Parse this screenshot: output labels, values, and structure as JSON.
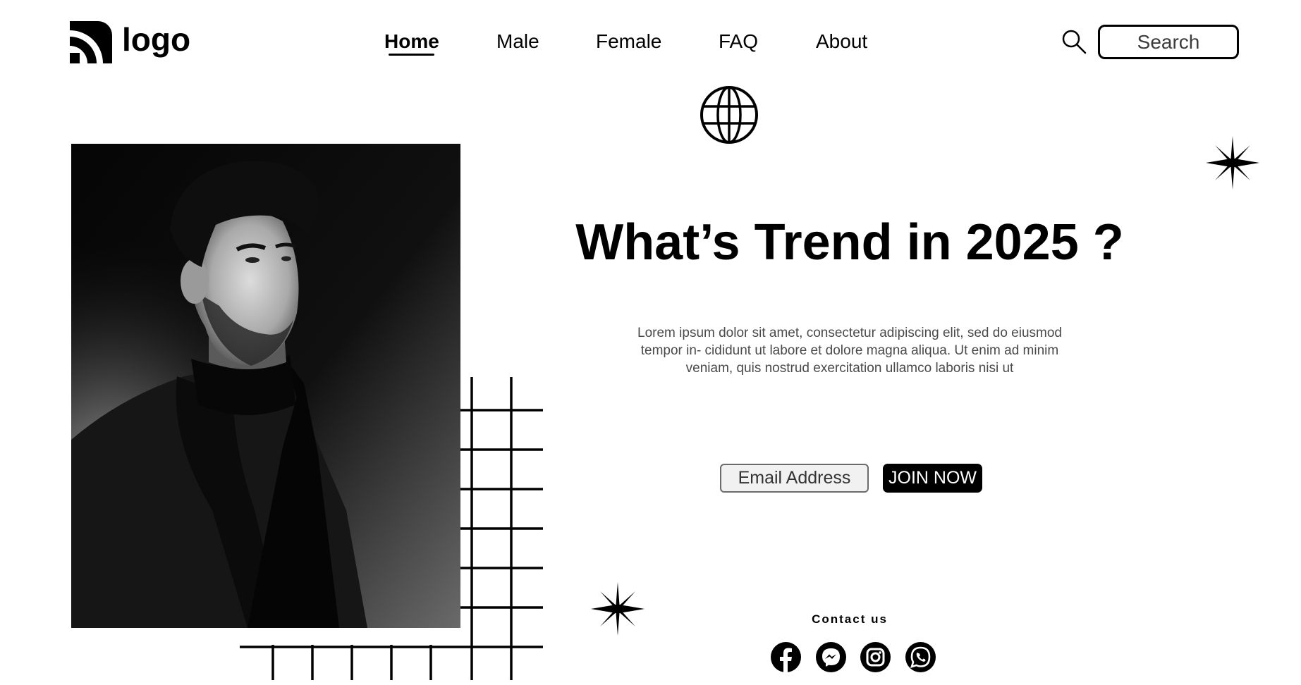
{
  "header": {
    "logo_text": "logo",
    "nav": [
      {
        "label": "Home",
        "active": true
      },
      {
        "label": "Male",
        "active": false
      },
      {
        "label": "Female",
        "active": false
      },
      {
        "label": "FAQ",
        "active": false
      },
      {
        "label": "About",
        "active": false
      }
    ],
    "search": {
      "placeholder": "Search",
      "icon": "search-icon"
    }
  },
  "hero": {
    "title": "What’s Trend in 2025 ?",
    "description": "Lorem ipsum dolor sit amet, consectetur adipiscing elit, sed do eiusmod tempor in- cididunt ut labore et dolore magna aliqua. Ut enim ad minim veniam, quis nostrud exercitation ullamco laboris nisi ut"
  },
  "subscribe": {
    "email_placeholder": "Email Address",
    "button_label": "JOIN NOW"
  },
  "contact": {
    "title": "Contact us",
    "socials": [
      "facebook-icon",
      "messenger-icon",
      "instagram-icon",
      "whatsapp-icon"
    ]
  },
  "colors": {
    "background": "#ffffff",
    "text": "#000000",
    "body_text": "#4a4a4a",
    "button_bg": "#000000",
    "button_text": "#ffffff"
  }
}
